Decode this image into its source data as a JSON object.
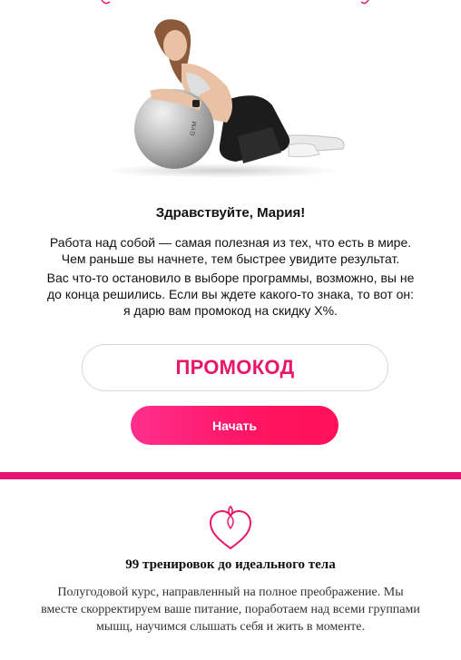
{
  "email": {
    "greeting": "Здравствуйте, Мария!",
    "paragraph_1": "Работа над собой — самая полезная из тех, что есть в мире. Чем раньше вы начнете, тем быстрее увидите результат.",
    "paragraph_2": "Вас что-то остановило в выборе программы, возможно, вы не до конца решились. Если вы ждете какого-то знака, то вот он: я дарю вам промокод на скидку X%.",
    "promo_code": "ПРОМОКОД",
    "start_button_label": "Начать"
  },
  "feature": {
    "icon": "heart-icon",
    "title": "99 тренировок до идеального тела",
    "text": "Полугодовой курс, направленный на полное преображение. Мы вместе скорректируем ваше питание, поработаем над всеми группами мышц, научимся слышать себя и  жить в моменте."
  },
  "colors": {
    "accent": "#e8166b",
    "divider": "#e4156d",
    "button_gradient_start": "#ff2f8d",
    "button_gradient_end": "#ff0f57"
  }
}
